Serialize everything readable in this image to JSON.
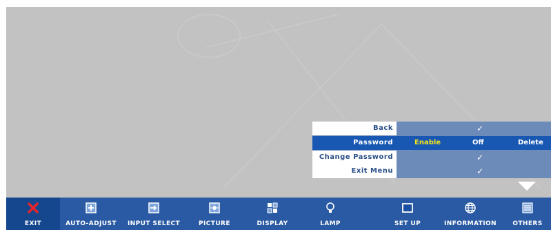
{
  "menu": {
    "rows": [
      {
        "label": "Back"
      },
      {
        "label": "Password",
        "options": [
          "Enable",
          "Off",
          "Delete"
        ],
        "active_option": "Enable"
      },
      {
        "label": "Change Password"
      },
      {
        "label": "Exit Menu"
      }
    ],
    "check": "✓"
  },
  "toolbar": {
    "items": [
      {
        "label": "EXIT",
        "icon": "close-icon"
      },
      {
        "label": "AUTO-ADJUST",
        "icon": "auto-adjust-icon"
      },
      {
        "label": "INPUT SELECT",
        "icon": "input-select-icon"
      },
      {
        "label": "PICTURE",
        "icon": "picture-icon"
      },
      {
        "label": "DISPLAY",
        "icon": "display-icon"
      },
      {
        "label": "LAMP",
        "icon": "lamp-icon"
      },
      {
        "label": "SET UP",
        "icon": "setup-icon"
      },
      {
        "label": "INFORMATION",
        "icon": "information-icon"
      },
      {
        "label": "OTHERS",
        "icon": "others-icon"
      }
    ]
  },
  "colors": {
    "screen_bg": "#c2c2c2",
    "menu_bg": "#6c8bb8",
    "selected_row": "#1858b3",
    "toolbar_bg": "#2a5aa3",
    "active_option": "#f6e51b",
    "exit_icon": "#e8242a"
  }
}
